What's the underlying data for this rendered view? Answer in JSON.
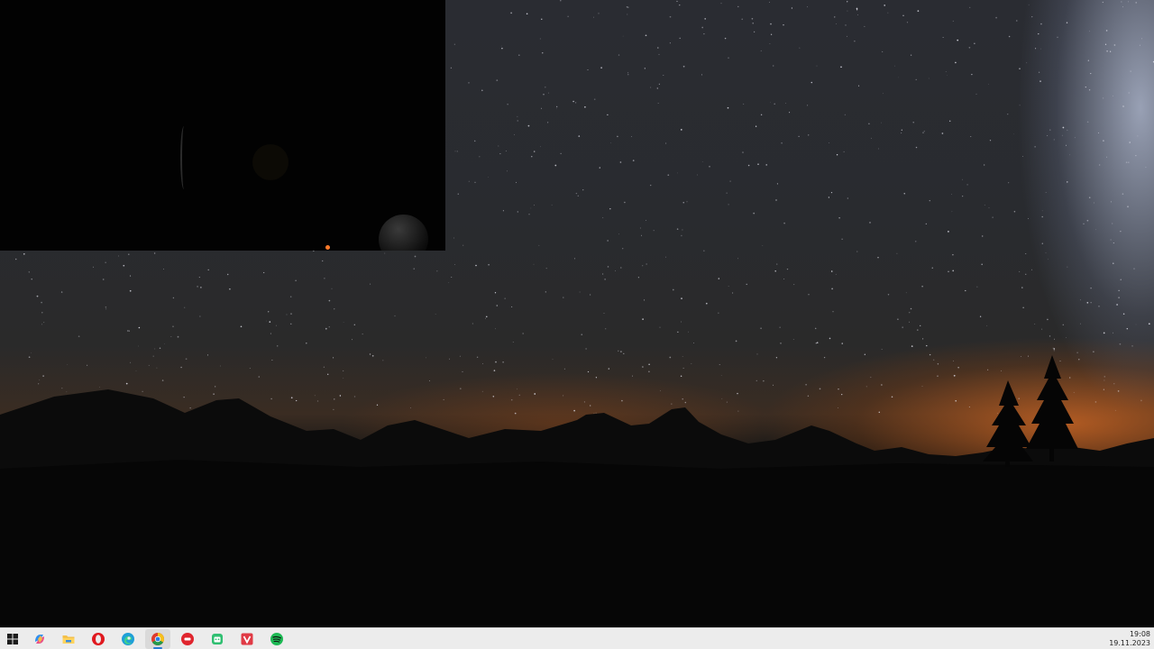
{
  "screen": {
    "wallpaper": "night-sky-mountain-silhouette",
    "colors": {
      "sky": "#292b2f",
      "horizon_glow": "#c8641e",
      "ground": "#0a0a0a",
      "taskbar": "#ececec"
    }
  },
  "video_window": {
    "background": "#020202"
  },
  "taskbar": {
    "start_icon": "windows-logo-icon",
    "apps": [
      {
        "id": "copilot",
        "icon": "copilot-icon",
        "active": false
      },
      {
        "id": "file-explorer",
        "icon": "folder-icon",
        "active": false
      },
      {
        "id": "opera",
        "icon": "opera-icon",
        "active": false
      },
      {
        "id": "edge",
        "icon": "edge-icon",
        "active": false
      },
      {
        "id": "chrome",
        "icon": "chrome-icon",
        "active": true
      },
      {
        "id": "red-app",
        "icon": "red-circle-app-icon",
        "active": false
      },
      {
        "id": "green-app",
        "icon": "green-bot-app-icon",
        "active": false
      },
      {
        "id": "vivaldi",
        "icon": "vivaldi-icon",
        "active": false
      },
      {
        "id": "spotify",
        "icon": "spotify-icon",
        "active": false
      }
    ],
    "clock": {
      "time": "19:08",
      "date": "19.11.2023"
    }
  }
}
